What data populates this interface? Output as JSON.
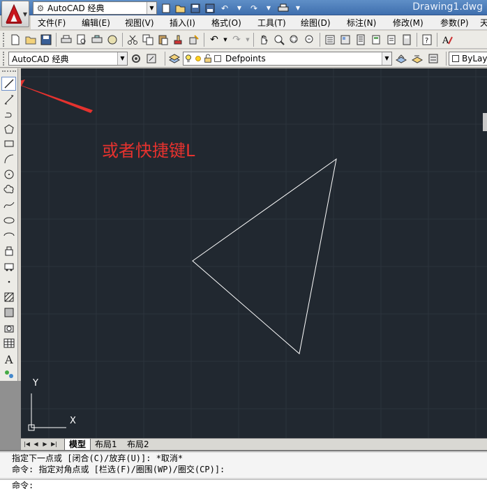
{
  "window": {
    "title": "Drawing1.dwg"
  },
  "workspace": {
    "value": "AutoCAD 经典"
  },
  "menu": [
    "文件(F)",
    "编辑(E)",
    "视图(V)",
    "插入(I)",
    "格式(O)",
    "工具(T)",
    "绘图(D)",
    "标注(N)",
    "修改(M)",
    "参数(P)",
    "天"
  ],
  "toolbar2": {
    "workspace_combo": "AutoCAD 经典",
    "layer_combo": "Defpoints",
    "linetype_combo": "ByLaye"
  },
  "canvas": {
    "annotation": "或者快捷键L",
    "ucs": {
      "x_label": "X",
      "y_label": "Y"
    }
  },
  "layout_tabs": [
    "模型",
    "布局1",
    "布局2"
  ],
  "command_line": {
    "history": [
      "指定下一点或 [闭合(C)/放弃(U)]: *取消*",
      "命令: 指定对角点或 [栏选(F)/圈围(WP)/圈交(CP)]:"
    ],
    "prompt": "命令:"
  },
  "colors": {
    "canvas_bg": "#212830",
    "annotation": "#e5322e",
    "arrow": "#e5322e",
    "geometry": "#ffffff"
  }
}
